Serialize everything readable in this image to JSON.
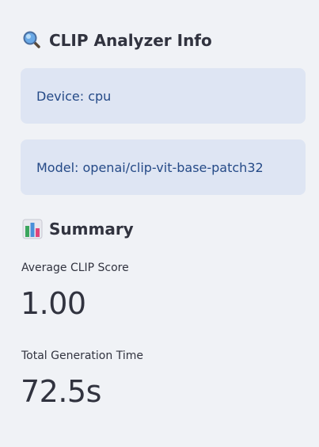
{
  "clip_info": {
    "heading": "CLIP Analyzer Info",
    "icon": "magnifying-glass-icon",
    "device_text": "Device: cpu",
    "model_text": "Model: openai/clip-vit-base-patch32"
  },
  "summary": {
    "heading": "Summary",
    "icon": "bar-chart-icon",
    "metrics": [
      {
        "label": "Average CLIP Score",
        "value": "1.00"
      },
      {
        "label": "Total Generation Time",
        "value": "72.5s"
      }
    ]
  },
  "colors": {
    "background": "#f0f2f6",
    "info_box": "#dee5f3",
    "info_text": "#254a87",
    "text": "#31333f"
  }
}
